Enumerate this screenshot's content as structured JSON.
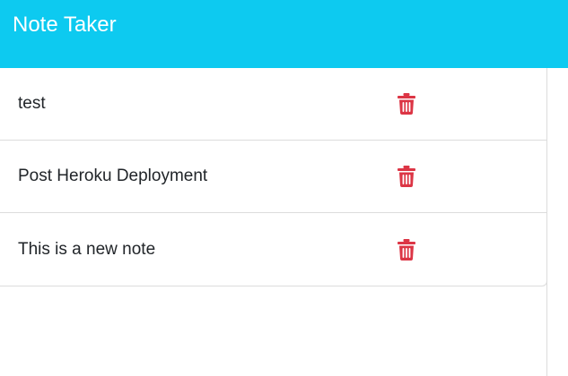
{
  "app": {
    "title": "Note Taker"
  },
  "colors": {
    "navbar": "#0dcaf0",
    "delete_icon": "#dc3545"
  },
  "notes": [
    {
      "title": "test",
      "icon": "trash-icon"
    },
    {
      "title": "Post Heroku Deployment",
      "icon": "trash-icon"
    },
    {
      "title": "This is a new note",
      "icon": "trash-icon"
    }
  ]
}
